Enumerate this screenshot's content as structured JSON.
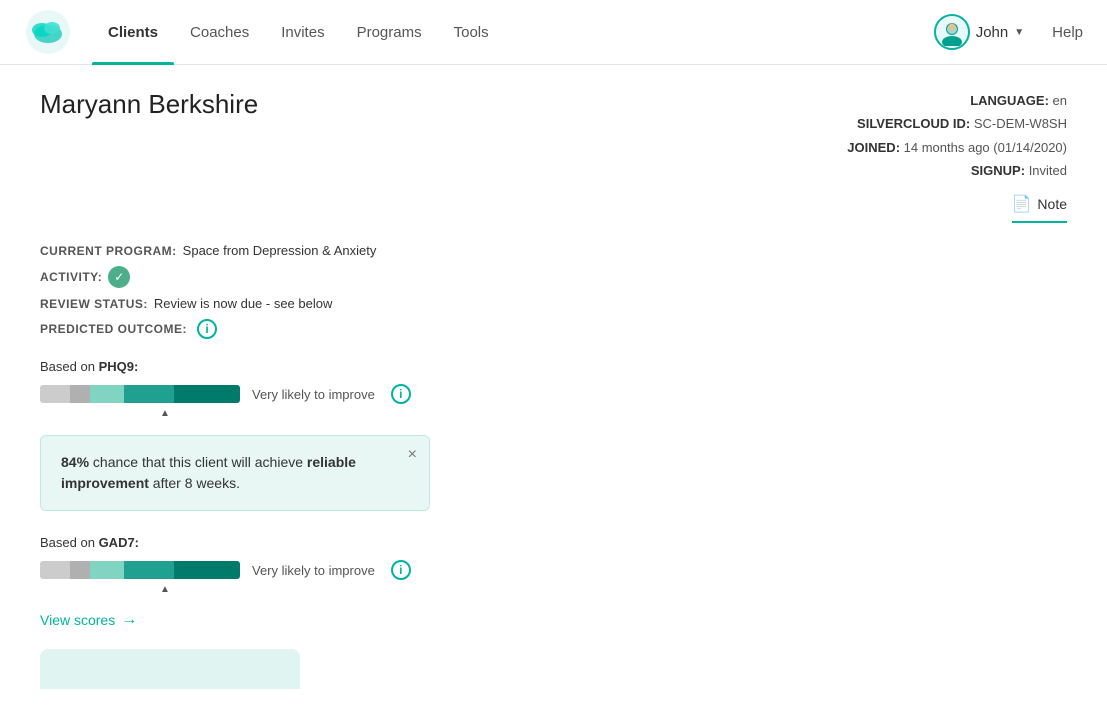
{
  "nav": {
    "links": [
      {
        "label": "Clients",
        "active": true
      },
      {
        "label": "Coaches",
        "active": false
      },
      {
        "label": "Invites",
        "active": false
      },
      {
        "label": "Programs",
        "active": false
      },
      {
        "label": "Tools",
        "active": false
      }
    ],
    "user": "John",
    "help": "Help"
  },
  "client": {
    "name": "Maryann Berkshire",
    "current_program_label": "CURRENT PROGRAM:",
    "current_program_value": "Space from Depression & Anxiety",
    "activity_label": "ACTIVITY:",
    "review_status_label": "REVIEW STATUS:",
    "review_status_value": "Review is now due - see below",
    "predicted_outcome_label": "PREDICTED OUTCOME:",
    "language_label": "LANGUAGE:",
    "language_value": "en",
    "silvercloud_id_label": "SILVERCLOUD ID:",
    "silvercloud_id_value": "SC-DEM-W8SH",
    "joined_label": "JOINED:",
    "joined_value": "14 months ago (01/14/2020)",
    "signup_label": "SIGNUP:",
    "signup_value": "Invited",
    "note_label": "Note"
  },
  "phq9": {
    "based_on_label": "Based on",
    "metric": "PHQ9:",
    "outcome": "Very likely to improve"
  },
  "tooltip": {
    "percentage": "84%",
    "text_before": " chance that this client will achieve ",
    "bold_text": "reliable improvement",
    "text_after": " after 8 weeks."
  },
  "gad7": {
    "based_on_label": "Based on",
    "metric": "GAD7:",
    "outcome": "Very likely to improve"
  },
  "view_scores": {
    "label": "View scores"
  }
}
